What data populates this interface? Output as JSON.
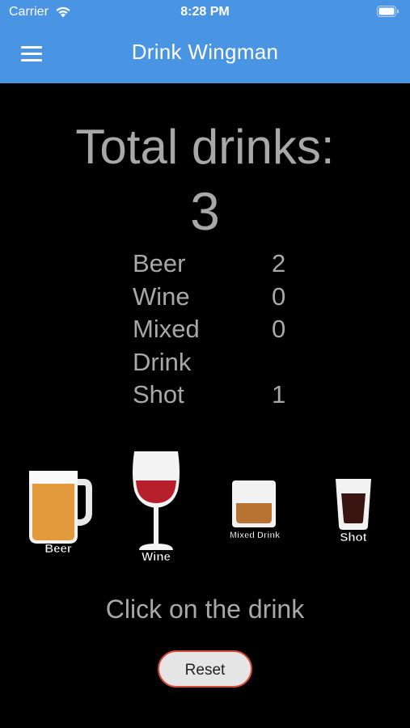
{
  "status_bar": {
    "carrier": "Carrier",
    "time": "8:28 PM"
  },
  "app_bar": {
    "title": "Drink Wingman"
  },
  "summary": {
    "total_label": "Total drinks:",
    "total_value": "3",
    "counts": [
      {
        "name": "Beer",
        "value": "2"
      },
      {
        "name": "Wine",
        "value": "0"
      },
      {
        "name": "Mixed Drink",
        "value": "0"
      },
      {
        "name": "Shot",
        "value": "1"
      }
    ]
  },
  "drinks": {
    "beer": "Beer",
    "wine": "Wine",
    "mixed": "Mixed Drink",
    "shot": "Shot"
  },
  "hint": "Click on the drink",
  "reset_label": "Reset",
  "colors": {
    "app_bar": "#4a94e4",
    "beer": "#e39a3c",
    "wine": "#b81f2c",
    "mixed": "#b87333",
    "shot": "#3a1410",
    "reset_border": "#d44a3a"
  }
}
